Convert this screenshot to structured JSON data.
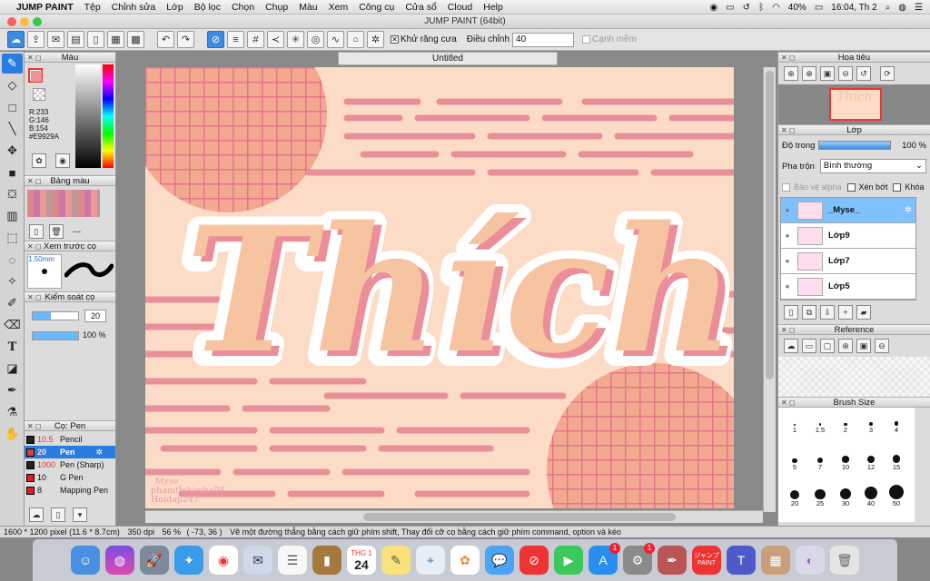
{
  "menubar": {
    "apple": "",
    "app": "JUMP PAINT",
    "items": [
      "Tệp",
      "Chỉnh sửa",
      "Lớp",
      "Bộ lọc",
      "Chọn",
      "Chụp",
      "Màu",
      "Xem",
      "Công cụ",
      "Cửa sổ",
      "Cloud",
      "Help"
    ],
    "battery": "40%",
    "clock": "16:04, Th 2"
  },
  "window": {
    "title": "JUMP PAINT (64bit)",
    "document_tab": "Untitled"
  },
  "toolbar": {
    "antialias_label": "Khử răng cưa",
    "adjust_label": "Điều chỉnh",
    "adjust_value": "40",
    "smooth_label": "Cạnh mềm"
  },
  "color_panel": {
    "title": "Màu",
    "r": "R:233",
    "g": "G:146",
    "b": "B:154",
    "hex": "#E9929A",
    "current_color": "#E9929A"
  },
  "palette_panel": {
    "title": "Bảng màu",
    "label": "---"
  },
  "brush_preview": {
    "title": "Xem trước cọ",
    "size": "1.50mm"
  },
  "brush_control": {
    "title": "Kiểm soát cọ",
    "size_value": "20",
    "opacity_value": "100 %",
    "opacity": 1.0
  },
  "pen_panel": {
    "title": "Cọ: Pen",
    "items": [
      {
        "size": "10.5",
        "name": "Pencil",
        "color": "#222222"
      },
      {
        "size": "20",
        "name": "Pen",
        "color": "#e04040"
      },
      {
        "size": "1000",
        "name": "Pen (Sharp)",
        "color": "#222222"
      },
      {
        "size": "10",
        "name": "G Pen",
        "color": "#e02020"
      },
      {
        "size": "8",
        "name": "Mapping Pen",
        "color": "#e02020"
      }
    ]
  },
  "navigator": {
    "title": "Hoa tiêu"
  },
  "layers": {
    "title": "Lớp",
    "opacity_label": "Độ trong",
    "opacity_value": "100 %",
    "opacity": 1.0,
    "blend_label": "Pha trộn",
    "blend_value": "Bình thường",
    "protect_alpha": "Bảo vệ alpha",
    "clip": "Xén bớt",
    "lock": "Khóa",
    "items": [
      "_Myse_",
      "Lớp9",
      "Lớp7",
      "Lớp5"
    ]
  },
  "reference": {
    "title": "Reference"
  },
  "brush_size": {
    "title": "Brush Size",
    "sizes": [
      "1",
      "1.5",
      "2",
      "3",
      "4",
      "5",
      "7",
      "10",
      "12",
      "15",
      "20",
      "25",
      "30",
      "40",
      "50"
    ]
  },
  "artwork": {
    "word": "Thích",
    "watermark": [
      "_Myse_",
      "phamthikimha08",
      "Hoidap247"
    ]
  },
  "statusbar": {
    "pixels": "1600 * 1200 pixel",
    "physical": "(11.6 * 8.7cm)",
    "dpi": "350 dpi",
    "zoom": "56 %",
    "coords": "( -73, 36 )",
    "hint": "Vẽ một đường thẳng bằng cách giữ phím shift, Thay đổi cỡ cọ bằng cách giữ phím command, option và kéo"
  },
  "dock": {
    "calendar_month": "THG 1",
    "calendar_day": "24",
    "appstore_badge": "1",
    "prefs_badge": "1",
    "jump_label": "ジャンプ PAINT"
  }
}
